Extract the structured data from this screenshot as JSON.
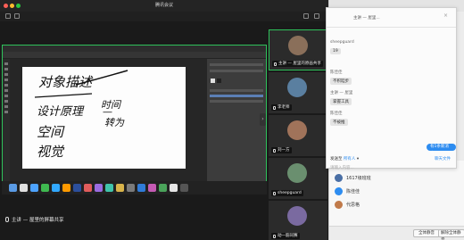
{
  "window": {
    "title": "腾讯会议"
  },
  "share": {
    "presenter_label": "主讲 — 屋里的屏幕共享",
    "handwriting": [
      "对象描述",
      "设计原理",
      "时间",
      "空间",
      "视觉",
      "转为"
    ]
  },
  "participants": [
    {
      "name": "主讲 — 屋里的原画共享",
      "color": "#8a6f5a",
      "active": true
    },
    {
      "name": "李老师",
      "color": "#5a7fa0",
      "active": false
    },
    {
      "name": "刘一方",
      "color": "#a0735a",
      "active": false
    },
    {
      "name": "sheepguard",
      "color": "#6a8f6f",
      "active": false
    },
    {
      "name": "动一筋同赛",
      "color": "#7a6aa0",
      "active": false
    }
  ],
  "chat": {
    "header": "主讲 — 屋里...",
    "messages": [
      {
        "kind": "label",
        "text": "sheepguard"
      },
      {
        "kind": "bubble",
        "text": "19"
      },
      {
        "kind": "label",
        "text": "陈佳佳"
      },
      {
        "kind": "bubble",
        "text": "不积跬步"
      },
      {
        "kind": "label",
        "text": "主讲 — 屋里"
      },
      {
        "kind": "bubble",
        "text": "掌握工具"
      },
      {
        "kind": "label",
        "text": "陈佳佳"
      },
      {
        "kind": "bubble",
        "text": "不被推"
      }
    ],
    "new_messages": "有1条新消息",
    "send_to_label": "发送至",
    "send_to_value": "所有人",
    "send_file": "聊天文件",
    "input_placeholder": "请输入内容..."
  },
  "members": [
    {
      "name": "1617级班班",
      "color": "#4a6fa5"
    },
    {
      "name": "陈佳佳",
      "color": "#2d8cf0"
    },
    {
      "name": "代思格",
      "color": "#c07a4a"
    }
  ],
  "side_buttons": {
    "mute_all": "全体静音",
    "unmute_all": "解除全体静音"
  }
}
